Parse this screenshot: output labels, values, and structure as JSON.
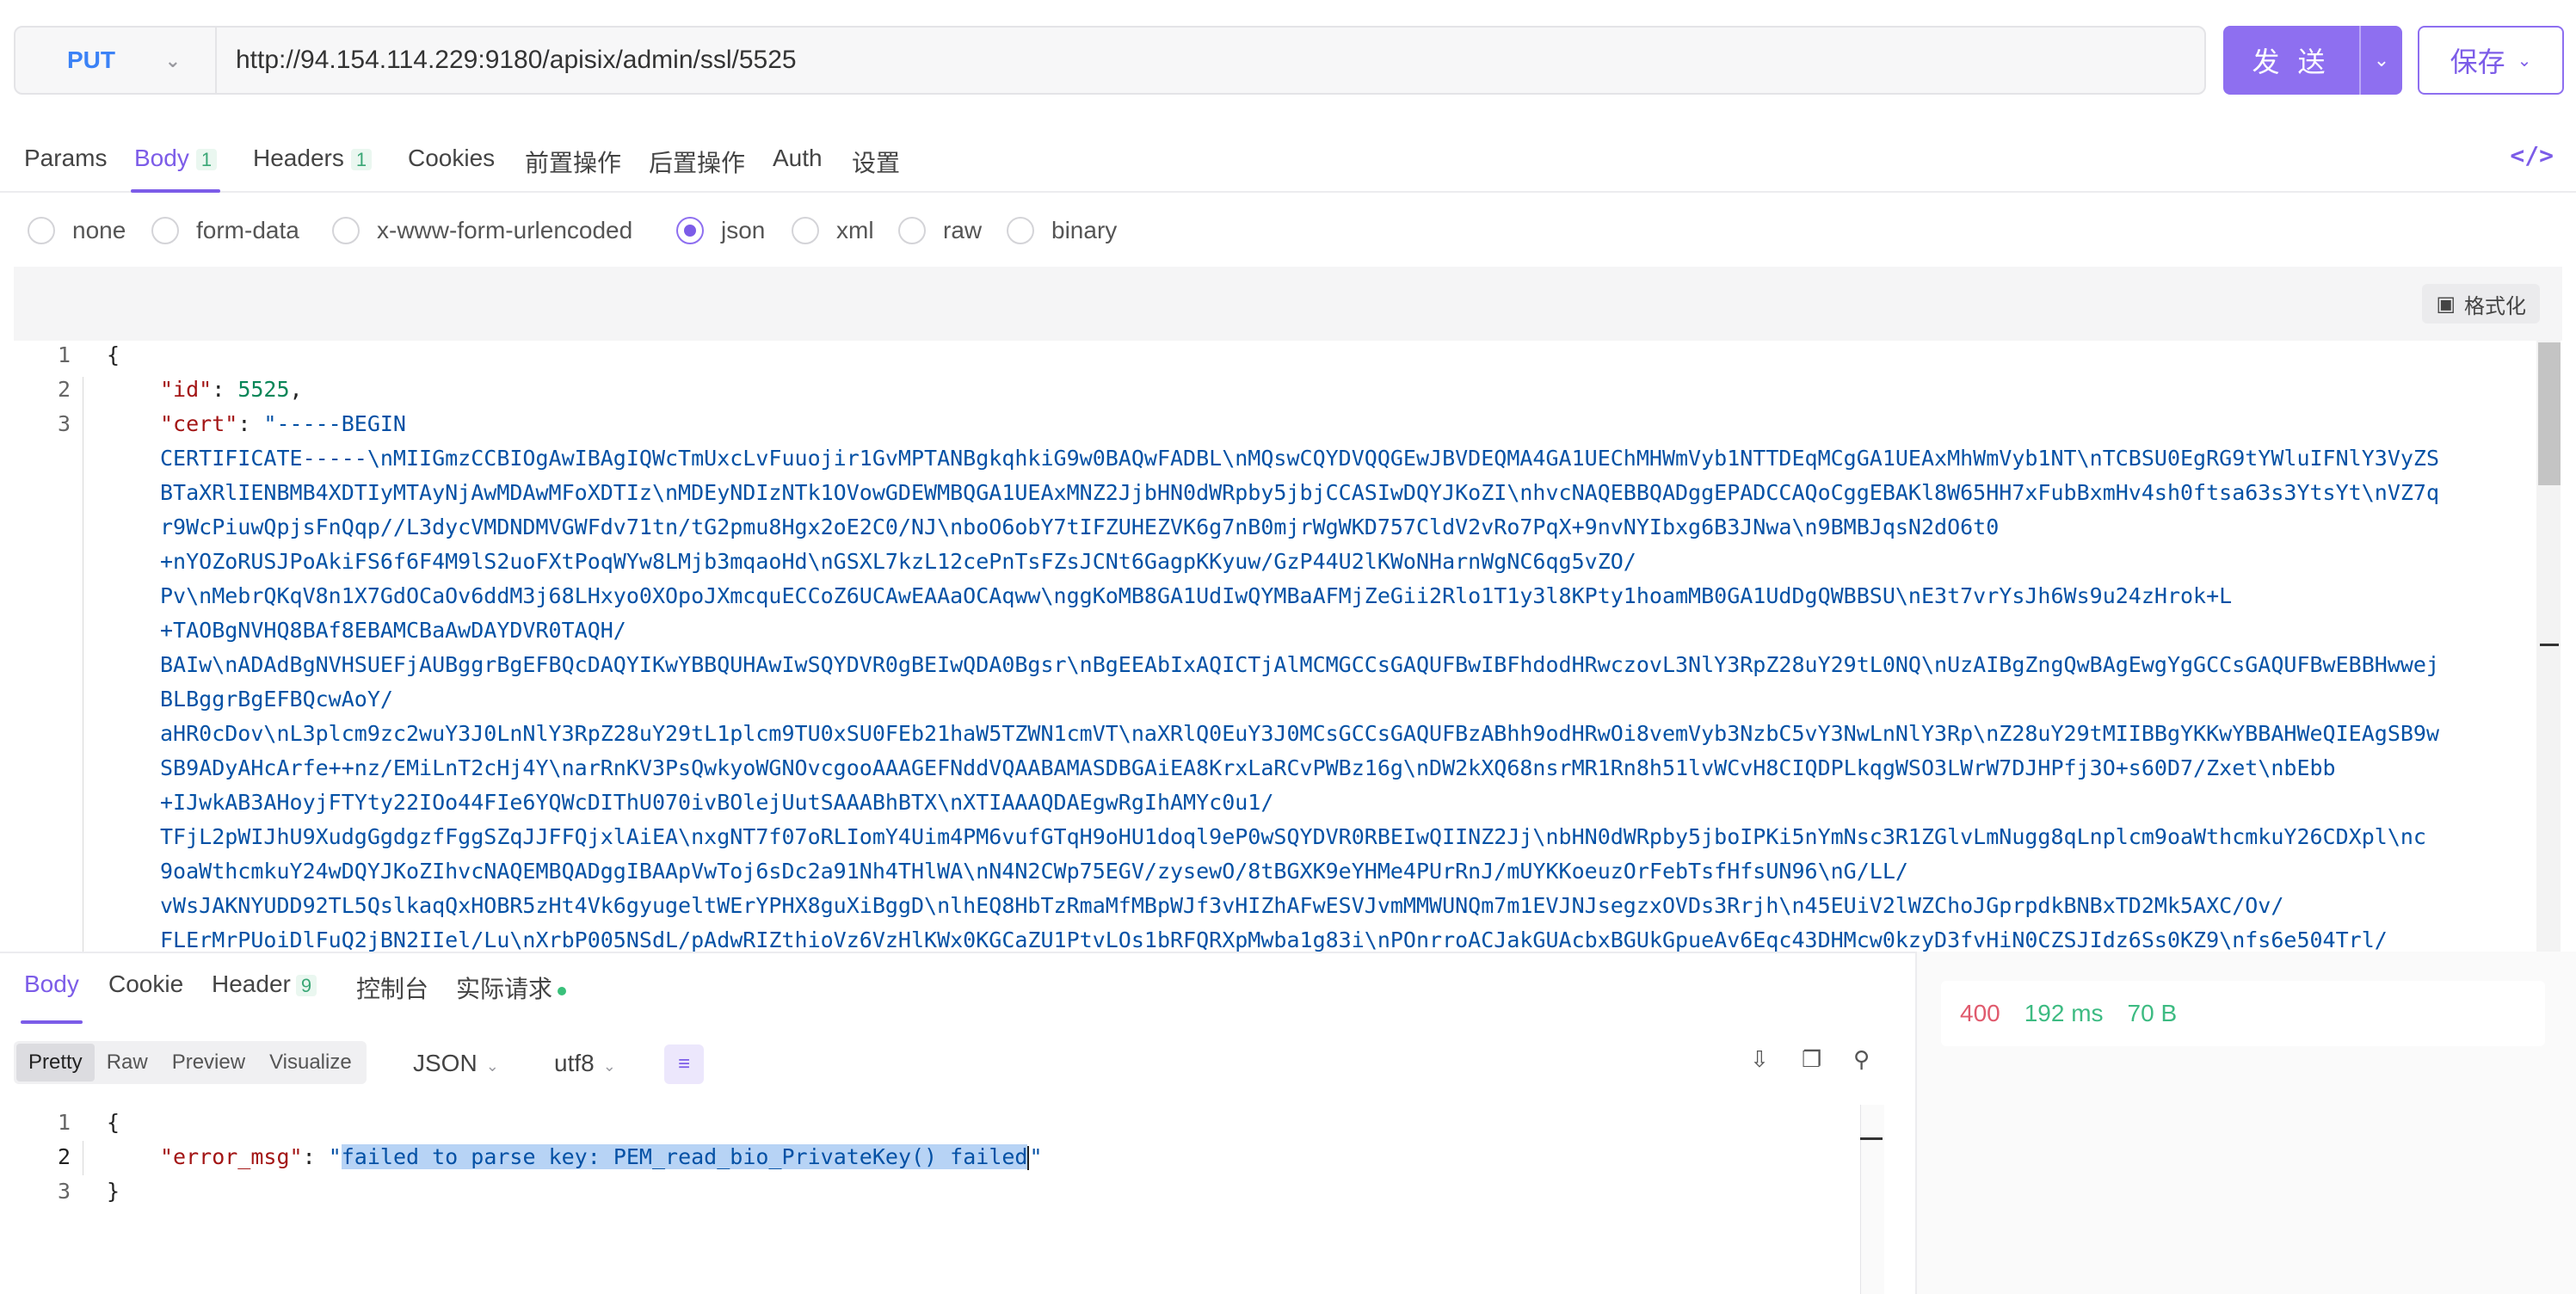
{
  "request": {
    "method": "PUT",
    "url": "http://94.154.114.229:9180/apisix/admin/ssl/5525",
    "send_label": "发 送",
    "save_label": "保存"
  },
  "request_tabs": [
    {
      "label": "Params",
      "badge": ""
    },
    {
      "label": "Body",
      "badge": "1"
    },
    {
      "label": "Headers",
      "badge": "1"
    },
    {
      "label": "Cookies",
      "badge": ""
    },
    {
      "label": "前置操作",
      "badge": ""
    },
    {
      "label": "后置操作",
      "badge": ""
    },
    {
      "label": "Auth",
      "badge": ""
    },
    {
      "label": "设置",
      "badge": ""
    }
  ],
  "body_types": [
    "none",
    "form-data",
    "x-www-form-urlencoded",
    "json",
    "xml",
    "raw",
    "binary"
  ],
  "selected_body_type": "json",
  "format_label": "格式化",
  "request_body": {
    "line_numbers": [
      "1",
      "2",
      "3"
    ],
    "open_brace": "{",
    "id_key": "\"id\"",
    "id_value": "5525",
    "cert_key": "\"cert\"",
    "cert_lines": [
      "\"-----BEGIN",
      "CERTIFICATE-----\\nMIIGmzCCBIOgAwIBAgIQWcTmUxcLvFuuojir1GvMPTANBgkqhkiG9w0BAQwFADBL\\nMQswCQYDVQQGEwJBVDEQMA4GA1UEChMHWmVyb1NTTDEqMCgGA1UEAxMhWmVyb1NT\\nTCBSU0EgRG9tYWluIFNlY3VyZS",
      "BTaXRlIENBMB4XDTIyMTAyNjAwMDAwMFoXDTIz\\nMDEyNDIzNTk1OVowGDEWMBQGA1UEAxMNZ2JjbHN0dWRpby5jbjCCASIwDQYJKoZI\\nhvcNAQEBBQADggEPADCCAQoCggEBAKl8W65HH7xFubBxmHv4sh0ftsa63s3YtsYt\\nVZ7q",
      "r9WcPiuwQpjsFnQqp//L3dycVMDNDMVGWFdv71tn/tG2pmu8Hgx2oE2C0/NJ\\nboO6obY7tIFZUHEZVK6g7nB0mjrWgWKD757CldV2vRo7PqX+9nvNYIbxg6B3JNwa\\n9BMBJqsN2dO6t0",
      "+nYOZoRUSJPoAkiFS6f6F4M9lS2uoFXtPoqWYw8LMjb3mqaoHd\\nGSXL7kzL12cePnTsFZsJCNt6GagpKKyuw/GzP44U2lKWoNHarnWgNC6qg5vZO/",
      "Pv\\nMebrQKqV8n1X7GdOCaOv6ddM3j68LHxyo0XOpoJXmcquECCoZ6UCAwEAAaOCAqww\\nggKoMB8GA1UdIwQYMBaAFMjZeGii2Rlo1T1y3l8KPty1hoamMB0GA1UdDgQWBBSU\\nE3t7vrYsJh6Ws9u24zHrok+L",
      "+TAOBgNVHQ8BAf8EBAMCBaAwDAYDVR0TAQH/",
      "BAIw\\nADAdBgNVHSUEFjAUBggrBgEFBQcDAQYIKwYBBQUHAwIwSQYDVR0gBEIwQDA0Bgsr\\nBgEEAbIxAQICTjAlMCMGCCsGAQUFBwIBFhdodHRwczovL3NlY3RpZ28uY29tL0NQ\\nUzAIBgZngQwBAgEwgYgGCCsGAQUFBwEBBHwwej",
      "BLBggrBgEFBQcwAoY/",
      "aHR0cDov\\nL3plcm9zc2wuY3J0LnNlY3RpZ28uY29tL1plcm9TU0xSU0FEb21haW5TZWN1cmVT\\naXRlQ0EuY3J0MCsGCCsGAQUFBzABhh9odHRwOi8vemVyb3NzbC5vY3NwLnNlY3Rp\\nZ28uY29tMIIBBgYKKwYBBAHWeQIEAgSB9w",
      "SB9ADyAHcArfe++nz/EMiLnT2cHj4Y\\narRnKV3PsQwkyoWGNOvcgooAAAGEFNddVQAABAMASDBGAiEA8KrxLaRCvPWBz16g\\nDW2kXQ68nsrMR1Rn8h51lvWCvH8CIQDPLkqgWSO3LWrW7DJHPfj3O+s60D7/Zxet\\nbEbb",
      "+IJwkAB3AHoyjFTYty22IOo44FIe6YQWcDIThU070ivBOlejUutSAAABhBTX\\nXTIAAAQDAEgwRgIhAMYc0u1/",
      "TFjL2pWIJhU9XudgGgdgzfFggSZqJJFFQjxlAiEA\\nxgNT7f07oRLIomY4Uim4PM6vufGTqH9oHU1doql9eP0wSQYDVR0RBEIwQIINZ2Jj\\nbHN0dWRpby5jboIPKi5nYmNsc3R1ZGlvLmNugg8qLnplcm9oaWthcmkuY26CDXpl\\nc",
      "9oaWthcmkuY24wDQYJKoZIhvcNAQEMBQADggIBAApVwToj6sDc2a91Nh4THlWA\\nN4N2CWp75EGV/zysewO/8tBGXK9eYHMe4PUrRnJ/mUYKKoeuzOrFebTsfHfsUN96\\nG/LL/",
      "vWsJAKNYUDD92TL5QslkaqQxHOBR5zHt4Vk6gyugeltWErYPHX8guXiBggD\\nlhEQ8HbTzRmaMfMBpWJf3vHIZhAFwESVJvmMMWUNQm7m1EVJNJsegzxOVDs3Rrjh\\n45EUiV2lWZChoJGprpdkBNBxTD2Mk5AXC/Ov/",
      "FLErMrPUoiDlFuQ2jBN2IIel/Lu\\nXrbP005NSdL/pAdwRIZthioVz6VzHlKWx0KGCaZU1PtvLOs1bRFQRXpMwba1g83i\\nPOnrroACJakGUAcbxBGUkGpueAv6Eqc43DHMcw0kzyD3fvHiN0CZSJIdz6Ss0KZ9\\nfs6e504Trl/"
    ]
  },
  "response_tabs": [
    {
      "label": "Body",
      "badge": ""
    },
    {
      "label": "Cookie",
      "badge": ""
    },
    {
      "label": "Header",
      "badge": "9"
    },
    {
      "label": "控制台",
      "badge": ""
    },
    {
      "label": "实际请求",
      "badge": ""
    }
  ],
  "response_views": [
    "Pretty",
    "Raw",
    "Preview",
    "Visualize"
  ],
  "response_format": "JSON",
  "response_encoding": "utf8",
  "response_body": {
    "line_numbers": [
      "1",
      "2",
      "3"
    ],
    "open_brace": "{",
    "error_key": "\"error_msg\"",
    "error_value_open": "\"",
    "error_value_selected": "failed to parse key: PEM_read_bio_PrivateKey() failed",
    "error_value_close": "\"",
    "close_brace": "}"
  },
  "status": {
    "code": "400",
    "time": "192 ms",
    "size": "70 B"
  },
  "colors": {
    "accent": "#7c5ce8",
    "method": "#3b82f6",
    "status_error": "#e05a6d",
    "status_ok": "#3dbb82"
  }
}
